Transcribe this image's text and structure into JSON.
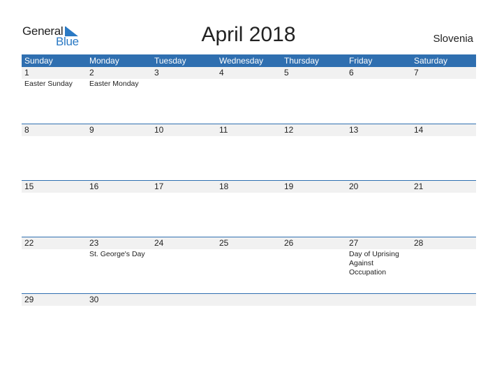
{
  "logo": {
    "word1": "General",
    "word2": "Blue"
  },
  "title": "April 2018",
  "country": "Slovenia",
  "weekdays": [
    "Sunday",
    "Monday",
    "Tuesday",
    "Wednesday",
    "Thursday",
    "Friday",
    "Saturday"
  ],
  "weeks": [
    {
      "days": [
        "1",
        "2",
        "3",
        "4",
        "5",
        "6",
        "7"
      ],
      "events": [
        "Easter Sunday",
        "Easter Monday",
        "",
        "",
        "",
        "",
        ""
      ]
    },
    {
      "days": [
        "8",
        "9",
        "10",
        "11",
        "12",
        "13",
        "14"
      ],
      "events": [
        "",
        "",
        "",
        "",
        "",
        "",
        ""
      ]
    },
    {
      "days": [
        "15",
        "16",
        "17",
        "18",
        "19",
        "20",
        "21"
      ],
      "events": [
        "",
        "",
        "",
        "",
        "",
        "",
        ""
      ]
    },
    {
      "days": [
        "22",
        "23",
        "24",
        "25",
        "26",
        "27",
        "28"
      ],
      "events": [
        "",
        "St. George's Day",
        "",
        "",
        "",
        "Day of Uprising Against Occupation",
        ""
      ]
    },
    {
      "days": [
        "29",
        "30",
        "",
        "",
        "",
        "",
        ""
      ],
      "events": [
        "",
        "",
        "",
        "",
        "",
        "",
        ""
      ]
    }
  ],
  "colors": {
    "accent": "#2f6fb0",
    "day_row_bg": "#f1f1f1",
    "logo_blue": "#2a79c4"
  }
}
